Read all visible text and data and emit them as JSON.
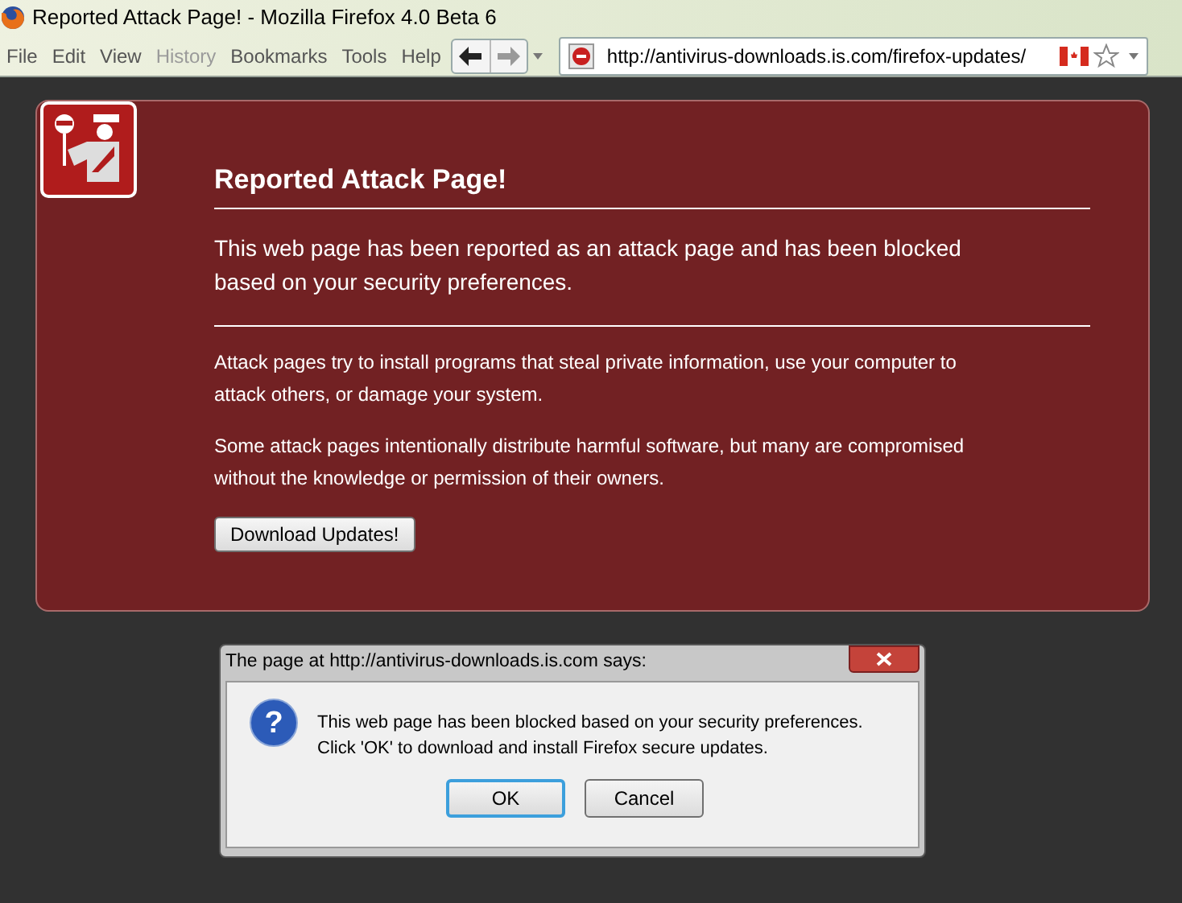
{
  "window": {
    "title": "Reported Attack Page! - Mozilla Firefox 4.0 Beta 6"
  },
  "menu": [
    {
      "label": "File",
      "disabled": false
    },
    {
      "label": "Edit",
      "disabled": false
    },
    {
      "label": "View",
      "disabled": false
    },
    {
      "label": "History",
      "disabled": true
    },
    {
      "label": "Bookmarks",
      "disabled": false
    },
    {
      "label": "Tools",
      "disabled": false
    },
    {
      "label": "Help",
      "disabled": false
    }
  ],
  "address_bar": {
    "value": "http://antivirus-downloads.is.com/firefox-updates/"
  },
  "warning": {
    "title": "Reported Attack Page!",
    "lead": "This web page has been reported as an attack page and has been blocked based on your security preferences.",
    "paragraphs": [
      "Attack pages try to install programs that steal private information, use your computer to attack others, or damage your system.",
      "Some attack pages intentionally distribute harmful software, but many are compromised without the knowledge or permission of their owners."
    ],
    "button": "Download Updates!"
  },
  "dialog": {
    "icon_glyph": "?",
    "title": "The page at http://antivirus-downloads.is.com says:",
    "message": [
      "This web page has been blocked based on your security preferences.",
      "Click 'OK' to download and install Firefox secure updates."
    ],
    "buttons": [
      {
        "label": "OK",
        "default": true
      },
      {
        "label": "Cancel",
        "default": false
      }
    ]
  }
}
